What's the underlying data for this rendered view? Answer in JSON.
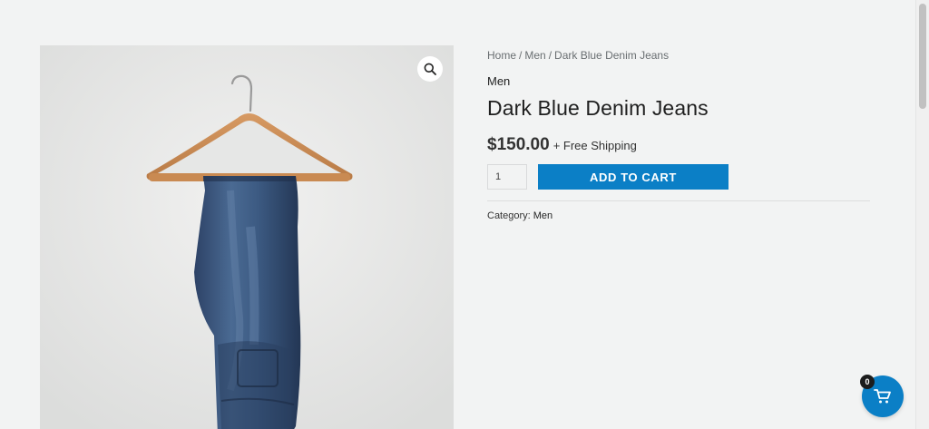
{
  "breadcrumb": {
    "home": "Home",
    "category": "Men",
    "current": "Dark Blue Denim Jeans",
    "separator": "/"
  },
  "product": {
    "category_label": "Men",
    "title": "Dark Blue Denim Jeans",
    "price": "$150.00",
    "shipping_note": "+ Free Shipping",
    "quantity": "1",
    "add_to_cart_label": "ADD TO CART",
    "meta_label": "Category:",
    "meta_value": "Men",
    "image_icon": "jeans-on-hanger",
    "zoom_icon": "magnifier-icon"
  },
  "mini_cart": {
    "count": "0",
    "icon": "cart-icon"
  },
  "colors": {
    "accent": "#0b7fc6",
    "background": "#f2f3f3"
  }
}
